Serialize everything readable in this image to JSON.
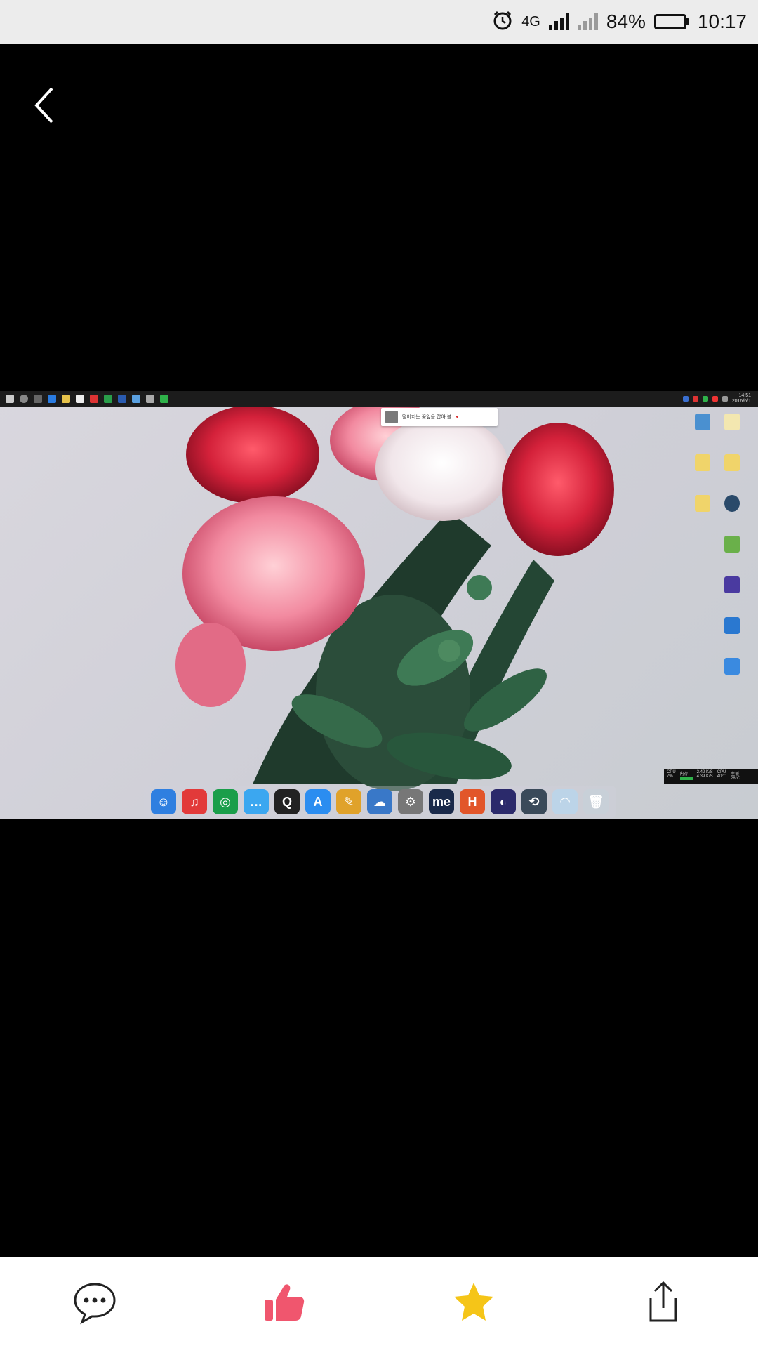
{
  "status_bar": {
    "alarm_icon": "alarm-clock-icon",
    "network_type": "4G",
    "battery_percent": "84%",
    "battery_level": 0.84,
    "time": "10:17"
  },
  "nav": {
    "back_icon": "chevron-left-icon"
  },
  "screenshot": {
    "taskbar_clock_time": "14:51",
    "taskbar_clock_date": "2016/6/1",
    "toast_text": "떨어지는 꽃잎을 잡아 볼",
    "toast_extra": "♥",
    "perf_widget": {
      "cpu_label": "CPU",
      "cpu_value": "7%",
      "mem_label": "内存",
      "up_rate": "2.42 K/S",
      "down_rate": "4.39 K/S",
      "cpu_temp_label": "CPU",
      "cpu_temp": "40°C",
      "disk_label": "主板",
      "disk_temp": "28°C"
    },
    "dock_items": [
      {
        "name": "finder",
        "color": "#2f7fe0",
        "glyph": "☺"
      },
      {
        "name": "itunes",
        "color": "#e23a3a",
        "glyph": "♫"
      },
      {
        "name": "chrome",
        "color": "#1a9e4a",
        "glyph": "◎"
      },
      {
        "name": "messages",
        "color": "#3ba7f0",
        "glyph": "…"
      },
      {
        "name": "qq",
        "color": "#222222",
        "glyph": "Q"
      },
      {
        "name": "app-store",
        "color": "#2b8df0",
        "glyph": "A"
      },
      {
        "name": "photos",
        "color": "#e0a22a",
        "glyph": "✎"
      },
      {
        "name": "drive",
        "color": "#3978c8",
        "glyph": "☁"
      },
      {
        "name": "settings",
        "color": "#777777",
        "glyph": "⚙"
      },
      {
        "name": "me",
        "color": "#1a2a4a",
        "glyph": "me"
      },
      {
        "name": "h-app",
        "color": "#e2562a",
        "glyph": "H"
      },
      {
        "name": "eclipse",
        "color": "#2b2a6b",
        "glyph": "◐"
      },
      {
        "name": "time-machine",
        "color": "#3a4a5a",
        "glyph": "⟲"
      },
      {
        "name": "wifi",
        "color": "#bcd4e8",
        "glyph": "◠"
      },
      {
        "name": "trash",
        "color": "#c8d0d8",
        "glyph": "🗑"
      }
    ]
  },
  "actions": {
    "comment_icon": "comment-bubble-icon",
    "like_icon": "thumbs-up-icon",
    "favorite_icon": "star-icon",
    "share_icon": "share-icon",
    "like_color": "#f0566e",
    "favorite_color": "#f5c518"
  }
}
